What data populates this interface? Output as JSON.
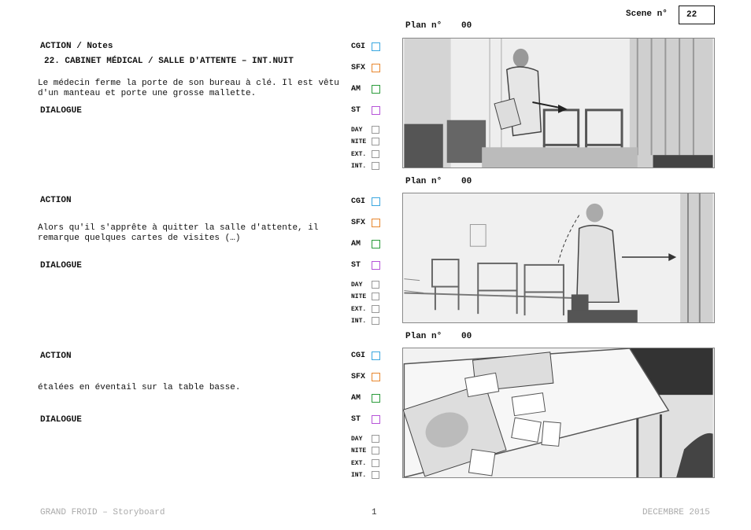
{
  "header": {
    "scene_label": "Scene n°",
    "scene_number": "22"
  },
  "tags": {
    "cgi": "CGI",
    "sfx": "SFX",
    "am": "AM",
    "st": "ST",
    "day": "DAY",
    "nite": "NITE",
    "ext": "EXT.",
    "int": "INT."
  },
  "tag_colors": {
    "cgi": "#3aa7e0",
    "sfx": "#e8872e",
    "am": "#2a9b3a",
    "st": "#b653d8",
    "plain": "#999999"
  },
  "shots": [
    {
      "plan_label": "Plan n°",
      "plan_number": "00",
      "action_label": "ACTION / Notes",
      "slug": "22. CABINET MÉDICAL / SALLE D'ATTENTE – INT.NUIT",
      "description": "Le médecin ferme la porte de son bureau à clé. Il est vêtu\nd'un manteau et porte une grosse mallette.",
      "dialogue_label": "DIALOGUE"
    },
    {
      "plan_label": "Plan n°",
      "plan_number": "00",
      "action_label": "ACTION",
      "description": "Alors qu'il s'apprête à quitter la salle d'attente, il\nremarque quelques cartes de visites (…)",
      "dialogue_label": "DIALOGUE"
    },
    {
      "plan_label": "Plan n°",
      "plan_number": "00",
      "action_label": "ACTION",
      "description": "étalées en éventail sur la table basse.",
      "dialogue_label": "DIALOGUE"
    }
  ],
  "footer": {
    "left": "GRAND FROID – Storyboard",
    "page": "1",
    "right": "DECEMBRE 2015"
  }
}
